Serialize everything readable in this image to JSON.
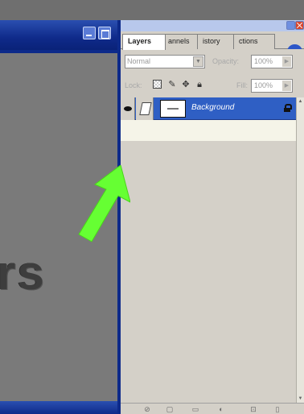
{
  "document": {
    "canvas_text": "rs"
  },
  "panel": {
    "tabs": [
      {
        "label": "Layers"
      },
      {
        "label": "annels"
      },
      {
        "label": "istory"
      },
      {
        "label": "ctions"
      }
    ],
    "menu_glyph": "▸",
    "blend_mode": "Normal",
    "opacity_label": "Opacity:",
    "opacity_value": "100%",
    "lock_label": "Lock:",
    "fill_label": "Fill:",
    "fill_value": "100%",
    "layer": {
      "name": "Background"
    }
  },
  "colors": {
    "titlebar": "#0f2a8a",
    "panel_bg": "#d4d0c8",
    "selected_layer": "#2f5fc4",
    "arrow": "#66ff33"
  }
}
